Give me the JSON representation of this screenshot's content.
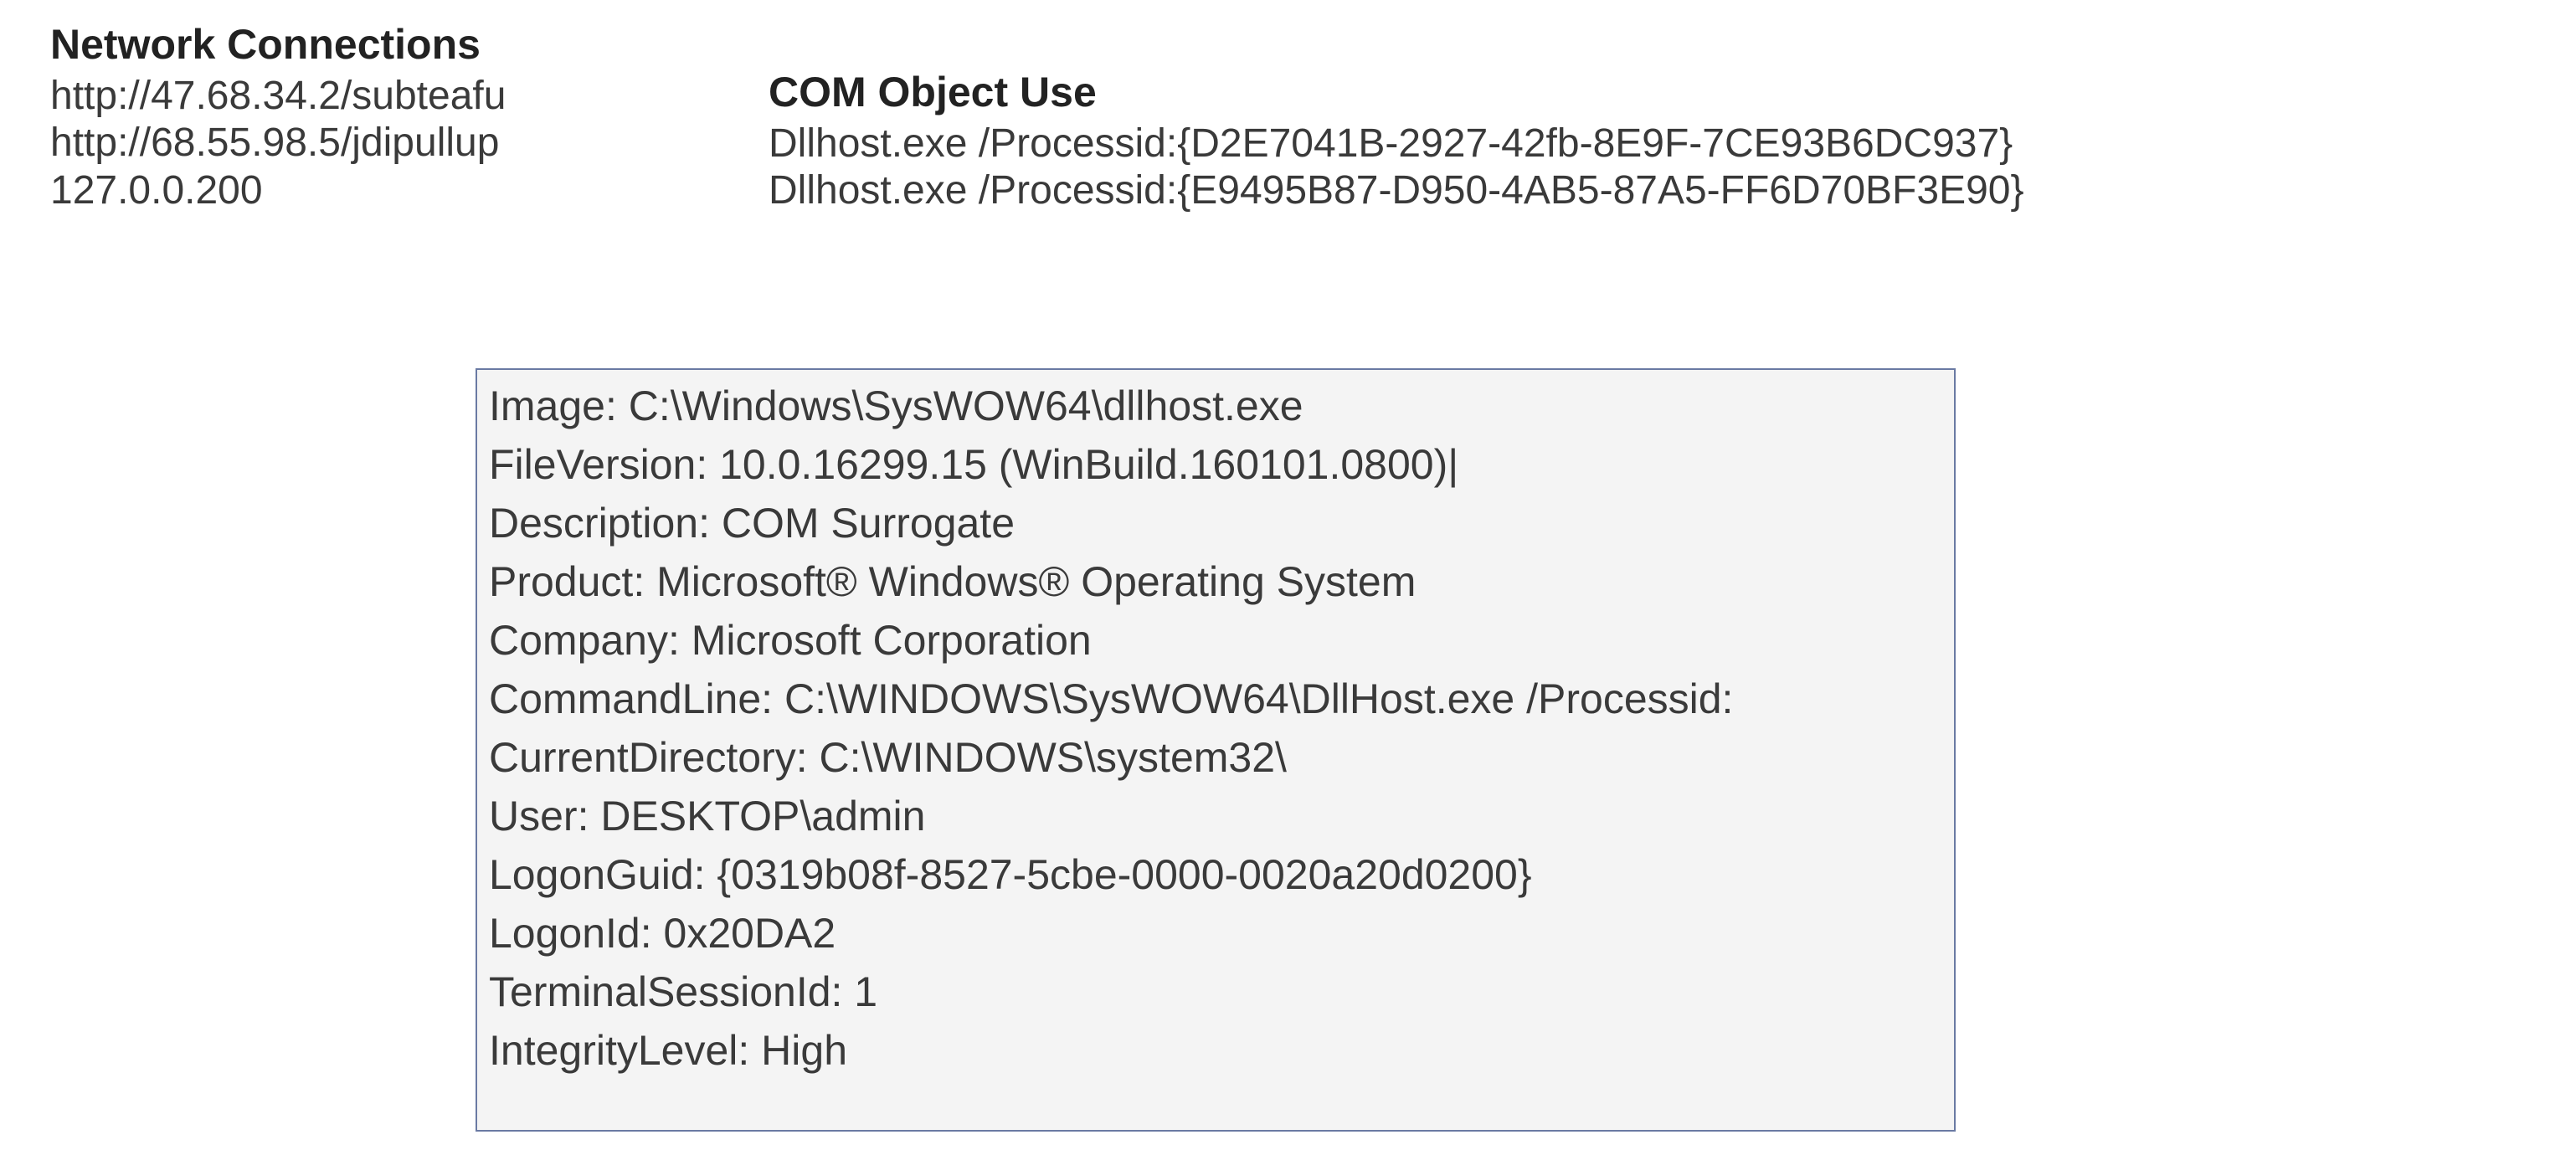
{
  "network": {
    "heading": "Network Connections",
    "items": [
      "http://47.68.34.2/subteafu",
      "http://68.55.98.5/jdipullup",
      "127.0.0.200"
    ]
  },
  "com": {
    "heading": "COM Object Use",
    "items": [
      "Dllhost.exe /Processid:{D2E7041B-2927-42fb-8E9F-7CE93B6DC937}",
      "Dllhost.exe /Processid:{E9495B87-D950-4AB5-87A5-FF6D70BF3E90}"
    ]
  },
  "details": {
    "lines": [
      "Image: C:\\Windows\\SysWOW64\\dllhost.exe",
      "FileVersion: 10.0.16299.15 (WinBuild.160101.0800)|",
      "Description: COM Surrogate",
      "Product: Microsoft® Windows® Operating System",
      "Company: Microsoft Corporation",
      "CommandLine: C:\\WINDOWS\\SysWOW64\\DllHost.exe /Processid:",
      "CurrentDirectory: C:\\WINDOWS\\system32\\",
      "User: DESKTOP\\admin",
      "LogonGuid: {0319b08f-8527-5cbe-0000-0020a20d0200}",
      "LogonId: 0x20DA2",
      "TerminalSessionId: 1",
      "IntegrityLevel: High"
    ]
  }
}
